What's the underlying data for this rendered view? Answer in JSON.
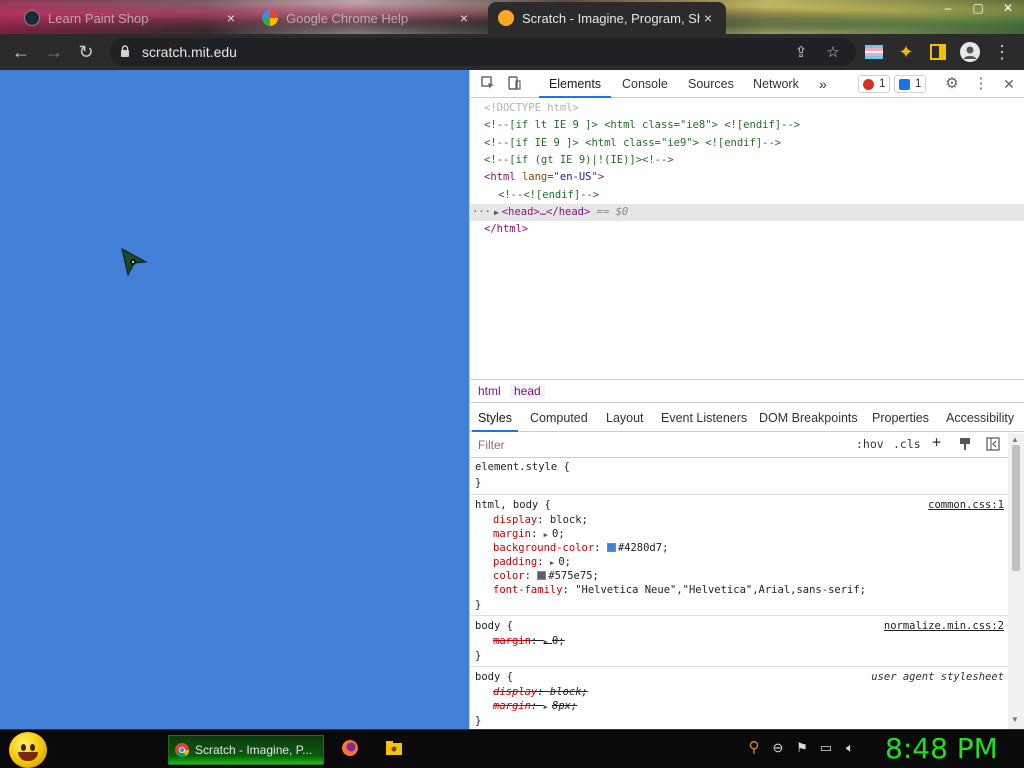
{
  "tabs": [
    {
      "title": "Learn Paint Shop",
      "close": "×"
    },
    {
      "title": "Google Chrome Help",
      "close": "×"
    },
    {
      "title": "Scratch - Imagine, Program, Share",
      "close": "×"
    }
  ],
  "window_controls": {
    "minimize": "–",
    "maximize": "▢",
    "close": "✕"
  },
  "toolbar": {
    "back": "←",
    "forward": "→",
    "reload": "↻",
    "url": "scratch.mit.edu",
    "share": "⇪",
    "bookmark": "☆",
    "extension": "✦",
    "menu": "⋮"
  },
  "devtools": {
    "tabs": [
      "Elements",
      "Console",
      "Sources",
      "Network"
    ],
    "more": "»",
    "error_count": "1",
    "message_count": "1",
    "settings": "⚙",
    "kebab": "⋮",
    "close": "✕",
    "dom": {
      "doctype": "<!DOCTYPE html>",
      "line1": "<!--[if lt IE 9 ]> <html class=\"ie8\"> <![endif]-->",
      "line2": "<!--[if IE 9 ]> <html class=\"ie9\"> <![endif]-->",
      "line3": "<!--[if (gt IE 9)|!(IE)]><!-->",
      "line4_tag": "<html ",
      "line4_attr": "lang",
      "line4_eq": "=\"",
      "line4_val": "en-US",
      "line4_end": "\">",
      "line5": "<!--<![endif]-->",
      "head_prefix": "···",
      "head_tag": "<head>…</head>",
      "head_suffix": " == $0",
      "html_close": "</html>"
    },
    "breadcrumbs": [
      "html",
      "head"
    ],
    "style_tabs": [
      "Styles",
      "Computed",
      "Layout",
      "Event Listeners",
      "DOM Breakpoints",
      "Properties",
      "Accessibility"
    ],
    "filter_placeholder": "Filter",
    "filter_buttons": {
      "hov": ":hov",
      "cls": ".cls",
      "add": "+"
    },
    "rules": {
      "element_style": {
        "selector": "element.style {",
        "close": "}"
      },
      "html_body": {
        "selector": "html, body {",
        "source": "common.css:1",
        "decls": [
          {
            "prop": "display",
            "val": "block;"
          },
          {
            "prop": "margin",
            "val": "0;"
          },
          {
            "prop": "background-color",
            "val": "#4280d7;"
          },
          {
            "prop": "padding",
            "val": "0;"
          },
          {
            "prop": "color",
            "val": "#575e75;"
          },
          {
            "prop": "font-family",
            "val": "\"Helvetica Neue\",\"Helvetica\",Arial,sans-serif;"
          }
        ],
        "close": "}"
      },
      "body_normalize": {
        "selector": "body {",
        "source": "normalize.min.css:2",
        "decls": [
          {
            "prop": "margin",
            "val": "0;"
          }
        ],
        "close": "}"
      },
      "body_ua": {
        "selector": "body {",
        "source": "user agent stylesheet",
        "decls": [
          {
            "prop": "display",
            "val": "block;"
          },
          {
            "prop": "margin",
            "val": "8px;"
          }
        ],
        "close": "}"
      }
    },
    "colon": ": "
  },
  "taskbar": {
    "chrome_label": "Scratch - Imagine, P...",
    "clock": "8:48 PM"
  },
  "colors": {
    "page_bg": "#4280d7",
    "text_color_swatch": "#575e75",
    "clock": "#1fe01f"
  },
  "icons": [
    "steam-icon",
    "google-icon",
    "scratch-icon",
    "lock-icon",
    "share-icon",
    "star-icon",
    "flag-icon",
    "puzzle-icon",
    "sidebar-icon",
    "profile-icon",
    "inspect-icon",
    "device-icon",
    "gear-icon",
    "firefox-icon",
    "folder-icon",
    "search-icon",
    "volume-icon"
  ]
}
